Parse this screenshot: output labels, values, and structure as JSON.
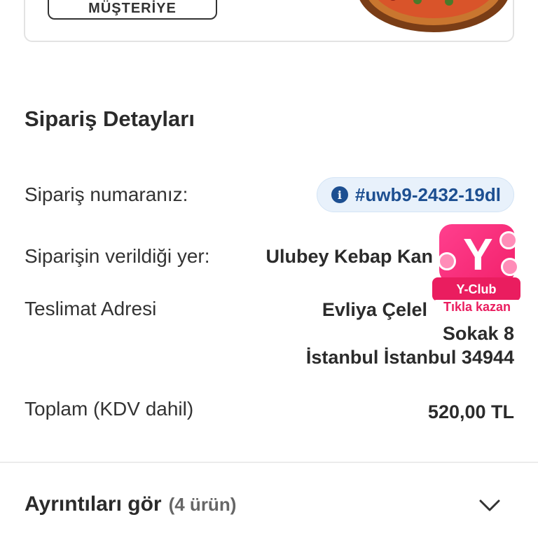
{
  "top_card": {
    "cta_label": "MÜŞTERİYE"
  },
  "order_details": {
    "title": "Sipariş Detayları",
    "order_number_label": "Sipariş numaranız:",
    "order_number_value": "#uwb9-2432-19dl",
    "order_number_icon": "info-icon",
    "place_label": "Siparişin verildiği yer:",
    "place_value": "Ulubey Kebap Kan",
    "address_label": "Teslimat Adresi",
    "address_lines": [
      "Evliya Çelel",
      "Sokak 8",
      "İstanbul İstanbul 34944"
    ],
    "total_label": "Toplam (KDV dahil)",
    "total_value": "520,00 TL"
  },
  "yclub": {
    "label": "Y-Club",
    "cta": "Tıkla kazan",
    "accent": "#ea1d5f"
  },
  "details_toggle": {
    "label": "Ayrıntıları gör",
    "count": "(4 ürün)",
    "icon": "chevron-down-icon"
  },
  "colors": {
    "brand_blue": "#1d4f91",
    "pill_bg": "#e8f1fb"
  }
}
